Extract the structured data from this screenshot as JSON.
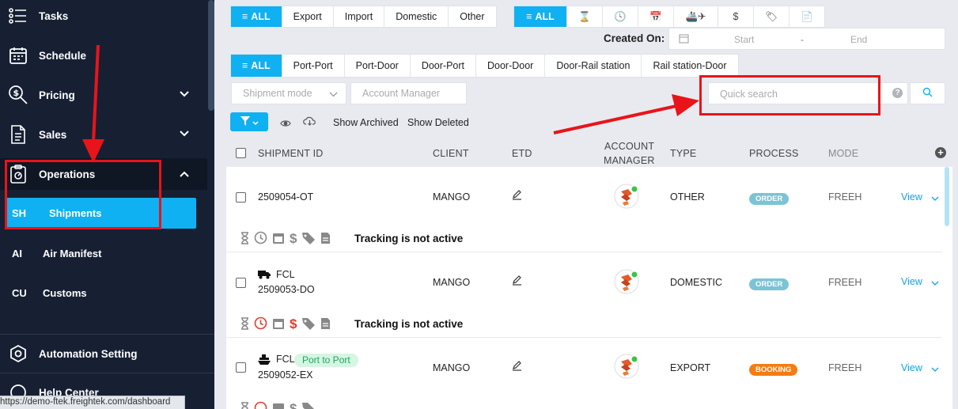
{
  "sidebar": {
    "items": [
      {
        "label": "Tasks",
        "icon": "tasks-icon"
      },
      {
        "label": "Schedule",
        "icon": "calendar-icon"
      },
      {
        "label": "Pricing",
        "icon": "pricing-icon"
      },
      {
        "label": "Sales",
        "icon": "sales-icon"
      },
      {
        "label": "Operations",
        "icon": "operations-icon"
      }
    ],
    "sub": [
      {
        "abbr": "SH",
        "label": "Shipments"
      },
      {
        "abbr": "AI",
        "label": "Air Manifest"
      },
      {
        "abbr": "CU",
        "label": "Customs"
      }
    ],
    "bottom": [
      {
        "label": "Automation Setting"
      },
      {
        "label": "Help Center"
      }
    ],
    "status_url": "https://demo-ftek.freightek.com/dashboard"
  },
  "filters": {
    "direction": [
      "ALL",
      "Export",
      "Import",
      "Domestic",
      "Other"
    ],
    "icons_all": "ALL",
    "created_on": "Created On:",
    "start_placeholder": "Start",
    "range_sep": "-",
    "end_placeholder": "End",
    "routes": [
      "ALL",
      "Port-Port",
      "Port-Door",
      "Door-Port",
      "Door-Door",
      "Door-Rail station",
      "Rail station-Door"
    ],
    "shipment_mode": "Shipment mode",
    "account_manager": "Account Manager",
    "quick_search": "Quick search",
    "help": "?",
    "show_archived": "Show Archived",
    "show_deleted": "Show Deleted"
  },
  "table": {
    "headers": {
      "shipment_id": "SHIPMENT ID",
      "client": "CLIENT",
      "etd": "ETD",
      "account_manager_1": "ACCOUNT",
      "account_manager_2": "MANAGER",
      "type": "TYPE",
      "process": "PROCESS",
      "mode": "MODE"
    },
    "plus": "+",
    "rows": [
      {
        "mode_label": "",
        "id": "2509054-OT",
        "client": "MANGO",
        "type": "OTHER",
        "process": "ORDER",
        "mode": "FREEH",
        "view": "View",
        "tracking": "Tracking is not active"
      },
      {
        "mode_label": "FCL",
        "id": "2509053-DO",
        "client": "MANGO",
        "type": "DOMESTIC",
        "process": "ORDER",
        "mode": "FREEH",
        "view": "View",
        "tracking": "Tracking is not active"
      },
      {
        "mode_label": "FCL",
        "route": "Port to Port",
        "id": "2509052-EX",
        "client": "MANGO",
        "type": "EXPORT",
        "process": "BOOKING",
        "mode": "FREEH",
        "view": "View"
      }
    ]
  },
  "colors": {
    "accent": "#0fb1f2",
    "sidebar": "#172033",
    "annotation": "#e8141a",
    "booking": "#f57c12",
    "order": "#7cc3d5"
  }
}
